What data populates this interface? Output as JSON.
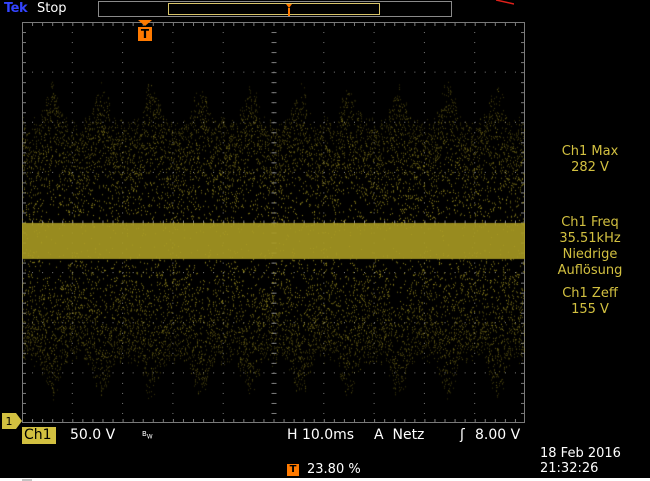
{
  "top_bar": {
    "brand": "Tek",
    "acquisition_state": "Stop"
  },
  "channel": {
    "marker_label": "1",
    "name": "Ch1",
    "vertical_scale": "50.0 V",
    "bandwidth_icon": "bandwidth-limit-icon"
  },
  "timebase": {
    "horizontal_scale": "H 10.0ms"
  },
  "trigger": {
    "label": "A  Netz",
    "slope_icon": "rising-edge-icon",
    "slope_glyph": "ʃ",
    "level": "8.00 V",
    "position_badge": "T",
    "position_value": "23.80 %"
  },
  "measurements": [
    {
      "label": "Ch1 Max",
      "value": "282 V"
    },
    {
      "label": "Ch1 Freq",
      "value": "35.51kHz",
      "note1": "Niedrige",
      "note2": "Auflösung"
    },
    {
      "label": "Ch1 Zeff",
      "value": "155 V"
    }
  ],
  "datetime": {
    "date": "18 Feb  2016",
    "time": "21:32:26"
  },
  "colors": {
    "ch1": "#d2c040",
    "trigger_marker": "#ff7a00",
    "graticule": "#7a7a7a",
    "brand": "#3344ff",
    "trace": "#a89a22"
  }
}
